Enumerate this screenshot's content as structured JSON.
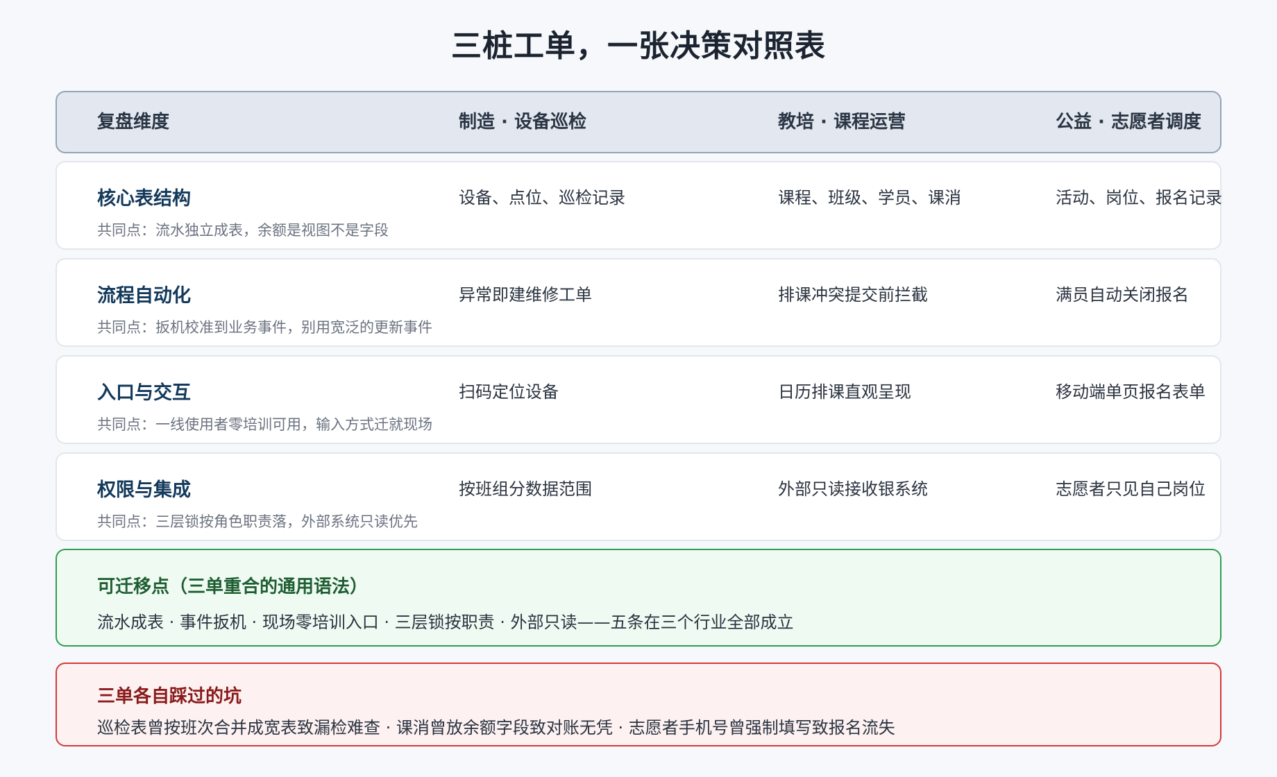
{
  "title": "三桩工单，一张决策对照表",
  "table": {
    "headers": [
      "复盘维度",
      "制造 · 设备巡检",
      "教培 · 课程运营",
      "公益 · 志愿者调度"
    ],
    "rows": [
      {
        "dimension": "核心表结构",
        "manufacturing": "设备、点位、巡检记录",
        "education": "课程、班级、学员、课消",
        "charity": "活动、岗位、报名记录",
        "common": "共同点：流水独立成表，余额是视图不是字段"
      },
      {
        "dimension": "流程自动化",
        "manufacturing": "异常即建维修工单",
        "education": "排课冲突提交前拦截",
        "charity": "满员自动关闭报名",
        "common": "共同点：扳机校准到业务事件，别用宽泛的更新事件"
      },
      {
        "dimension": "入口与交互",
        "manufacturing": "扫码定位设备",
        "education": "日历排课直观呈现",
        "charity": "移动端单页报名表单",
        "common": "共同点：一线使用者零培训可用，输入方式迁就现场"
      },
      {
        "dimension": "权限与集成",
        "manufacturing": "按班组分数据范围",
        "education": "外部只读接收银系统",
        "charity": "志愿者只见自己岗位",
        "common": "共同点：三层锁按角色职责落，外部系统只读优先"
      }
    ]
  },
  "transferable": {
    "title": "可迁移点（三单重合的通用语法）",
    "text": "流水成表 · 事件扳机 · 现场零培训入口 · 三层锁按职责 · 外部只读——五条在三个行业全部成立"
  },
  "pitfalls": {
    "title": "三单各自踩过的坑",
    "text": "巡检表曾按班次合并成宽表致漏检难查 · 课消曾放余额字段致对账无凭 · 志愿者手机号曾强制填写致报名流失"
  },
  "colors": {
    "header_bg": "#e3e8f0",
    "dimension_text": "#13395b",
    "transferable_border": "#2e9e4f",
    "pitfalls_border": "#d33a3a"
  }
}
